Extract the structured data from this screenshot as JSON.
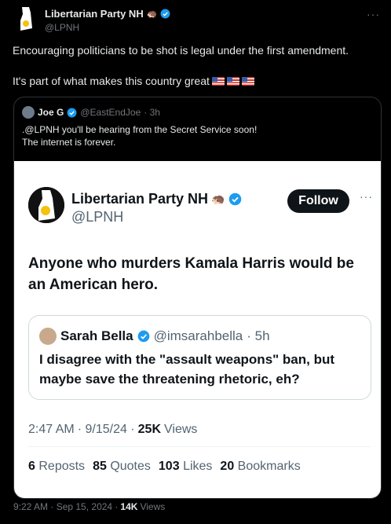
{
  "post": {
    "author_name": "Libertarian Party NH",
    "handle": "@LPNH",
    "more": "···",
    "text_line1": "Encouraging politicians to be shot is legal under the first amendment.",
    "text_line2": "It's part of what makes this country great",
    "flags": [
      "us-flag",
      "us-flag",
      "us-flag"
    ]
  },
  "quoted": {
    "author_name": "Joe G",
    "handle": "@EastEndJoe",
    "time": "· 3h",
    "text_line1": ".@LPNH you'll be hearing from the Secret Service soon!",
    "text_line2": "The internet is forever."
  },
  "screenshot": {
    "author_name": "Libertarian Party NH",
    "handle": "@LPNH",
    "follow_label": "Follow",
    "more": "···",
    "text": "Anyone who murders Kamala Harris would be an American hero.",
    "nested": {
      "author_name": "Sarah Bella",
      "handle": "@imsarahbella",
      "time": "· 5h",
      "text": "I disagree with the \"assault weapons\" ban, but maybe save the threatening rhetoric, eh?"
    },
    "meta": {
      "time": "2:47 AM",
      "date": "· 9/15/24 ·",
      "views_count": "25K",
      "views_label": "Views"
    },
    "stats": {
      "reposts_count": "6",
      "reposts_label": "Reposts",
      "quotes_count": "85",
      "quotes_label": "Quotes",
      "likes_count": "103",
      "likes_label": "Likes",
      "bookmarks_count": "20",
      "bookmarks_label": "Bookmarks"
    }
  },
  "footer": {
    "time": "9:22 AM · Sep 15, 2024 ·",
    "views_count": "14K",
    "views_label": "Views"
  },
  "colors": {
    "verified": "#1d9bf0",
    "background": "#000000",
    "secondary_text": "#71767b"
  }
}
